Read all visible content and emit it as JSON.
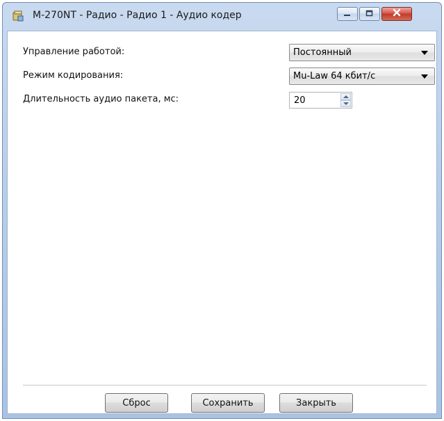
{
  "window": {
    "title": "M-270NT - Радио - Радио 1 - Аудио кодер",
    "icon": "app-window-icon",
    "controls": {
      "minimize_icon": "minimize-icon",
      "maximize_icon": "maximize-icon",
      "close_icon": "close-icon"
    }
  },
  "form": {
    "control_mode": {
      "label": "Управление работой:",
      "value": "Постоянный"
    },
    "encoding_mode": {
      "label": "Режим кодирования:",
      "value": "Mu-Law 64 кбит/с"
    },
    "packet_duration": {
      "label": "Длительность аудио пакета, мс:",
      "value": "20"
    }
  },
  "buttons": {
    "reset": "Сброс",
    "save": "Сохранить",
    "close": "Закрыть"
  },
  "colors": {
    "frame": "#b9cfea",
    "close_button": "#c13a2b"
  }
}
